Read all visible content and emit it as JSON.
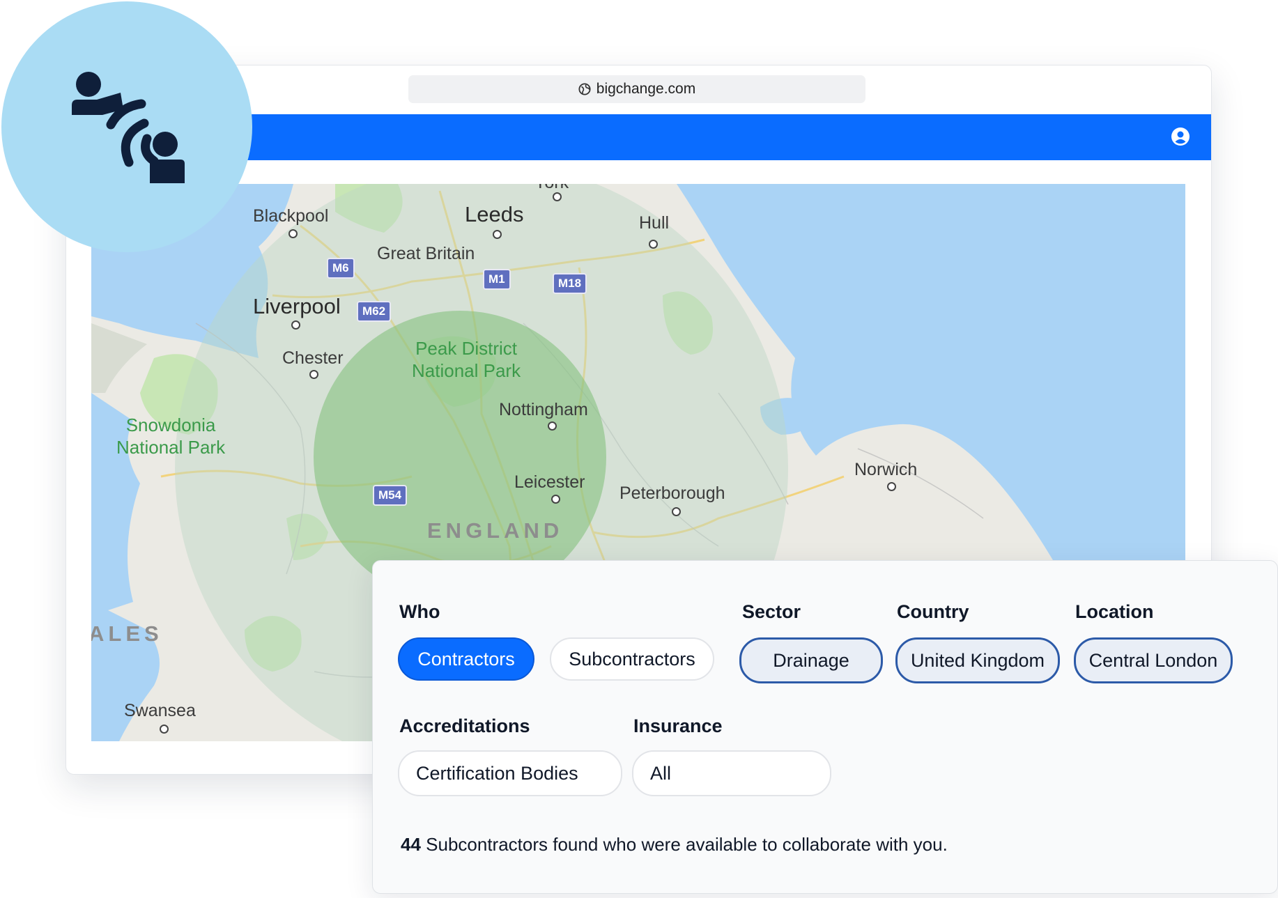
{
  "browser": {
    "url": "bigchange.com"
  },
  "map": {
    "cities": [
      {
        "name": "Blackpool",
        "big": false
      },
      {
        "name": "Leeds",
        "big": true
      },
      {
        "name": "York",
        "big": false
      },
      {
        "name": "Hull",
        "big": false
      },
      {
        "name": "Great Britain",
        "big": false
      },
      {
        "name": "Liverpool",
        "big": true
      },
      {
        "name": "Chester",
        "big": false
      },
      {
        "name": "Nottingham",
        "big": false
      },
      {
        "name": "Leicester",
        "big": false
      },
      {
        "name": "Peterborough",
        "big": false
      },
      {
        "name": "Norwich",
        "big": false
      },
      {
        "name": "Swansea",
        "big": false
      }
    ],
    "parks": [
      "Peak District\nNational Park",
      "Snowdonia\nNational Park"
    ],
    "regions": [
      "ENGLAND",
      "ALES"
    ],
    "roads": [
      "M6",
      "M1",
      "M18",
      "M62",
      "M54"
    ],
    "colors": {
      "sea": "#aad3f5",
      "land": "#ebeae4",
      "park": "#c8e6b5",
      "search_radius_outer": "#cfe3dc",
      "search_radius_inner": "#8fc98a"
    }
  },
  "filters": {
    "who": {
      "label": "Who",
      "options": [
        {
          "label": "Contractors",
          "active": true
        },
        {
          "label": "Subcontractors",
          "active": false
        }
      ]
    },
    "sector": {
      "label": "Sector",
      "value": "Drainage"
    },
    "country": {
      "label": "Country",
      "value": "United Kingdom"
    },
    "location": {
      "label": "Location",
      "value": "Central London"
    },
    "accreditations": {
      "label": "Accreditations",
      "value": "Certification Bodies"
    },
    "insurance": {
      "label": "Insurance",
      "value": "All"
    }
  },
  "result": {
    "count": "44",
    "text": " Subcontractors found who were available to collaborate with you."
  },
  "theme": {
    "primary": "#0a6cff",
    "badge_bg": "#aadcf4",
    "icon": "#0f1f3a"
  }
}
